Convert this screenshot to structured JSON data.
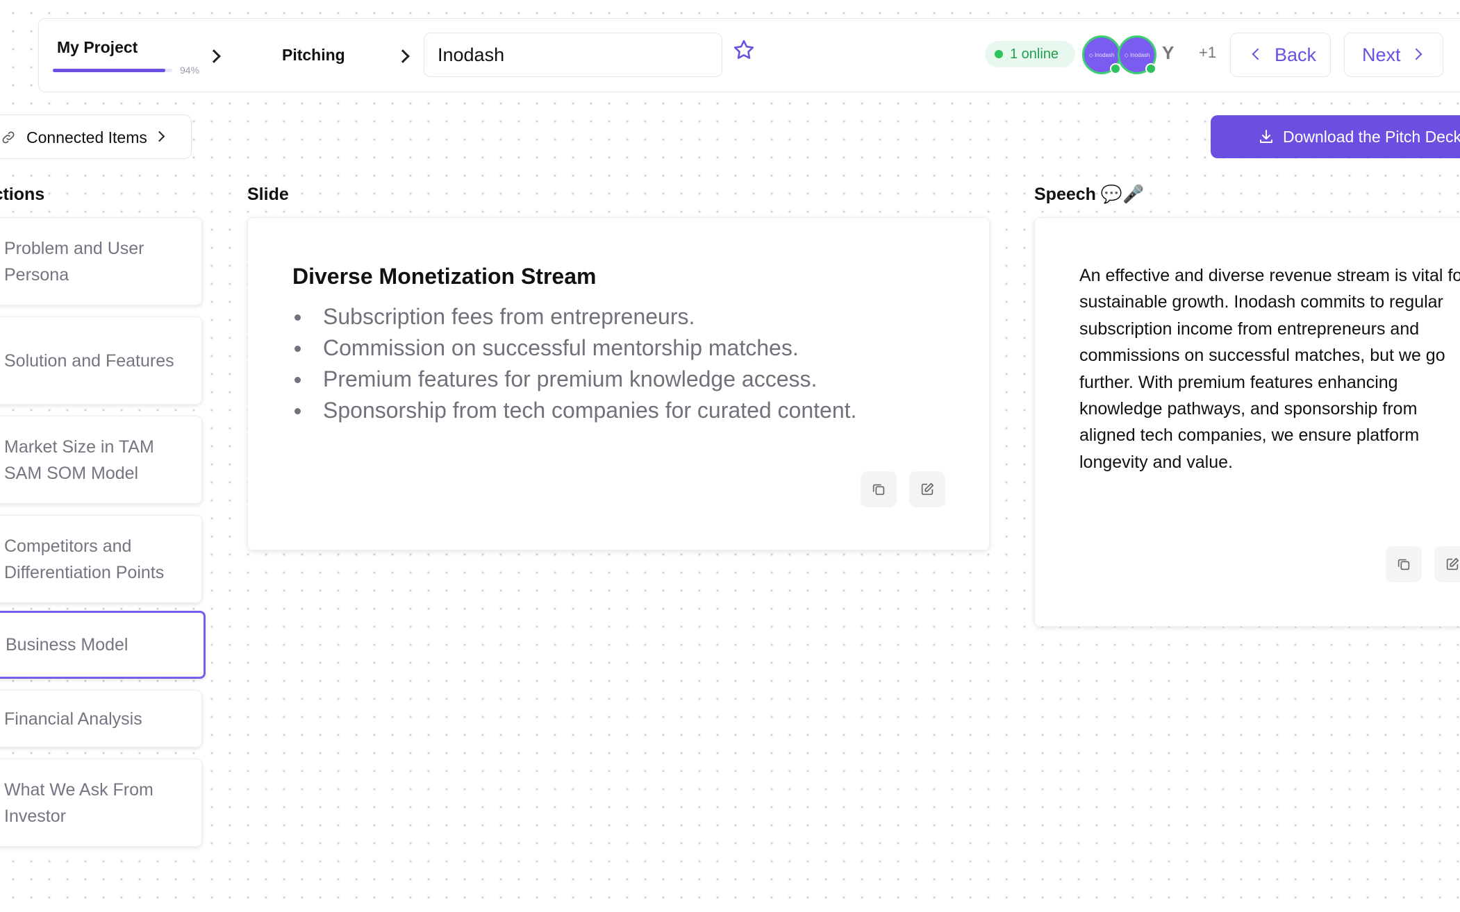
{
  "header": {
    "project_title": "My Project",
    "progress_percent": 94,
    "progress_label": "94%",
    "breadcrumb_step": "Pitching",
    "project_name_value": "Inodash",
    "online_status": "1 online",
    "avatar_text": "◇ Inodash",
    "user_initial": "Y",
    "more_users": "+1",
    "back_label": "Back",
    "next_label": "Next"
  },
  "toolbar": {
    "connected_items_label": "Connected Items",
    "download_label": "Download the Pitch Deck"
  },
  "columns": {
    "sections_heading": "Sections",
    "slide_heading": "Slide",
    "speech_heading": "Speech 💬🎤"
  },
  "sections": [
    {
      "label": "Problem and User Persona"
    },
    {
      "label": "Solution and Features"
    },
    {
      "label": "Market Size in TAM SAM SOM Model"
    },
    {
      "label": "Competitors and Differentiation Points"
    },
    {
      "label": "Business Model",
      "active": true
    },
    {
      "label": "Financial Analysis"
    },
    {
      "label": "What We Ask From Investor"
    }
  ],
  "slide": {
    "title": "Diverse Monetization Stream",
    "bullets": [
      "Subscription fees from entrepreneurs.",
      "Commission on successful mentorship matches.",
      "Premium features for premium knowledge access.",
      "Sponsorship from tech companies for curated content."
    ]
  },
  "speech": {
    "text": "An effective and diverse revenue stream is vital for sustainable growth. Inodash commits to regular subscription income from entrepreneurs and commissions on successful matches, but we go further. With premium features enhancing knowledge pathways, and sponsorship from aligned tech companies, we ensure platform longevity and value."
  },
  "colors": {
    "accent": "#6a4fe0",
    "online_green": "#2ec35c",
    "muted_text": "#737680"
  }
}
